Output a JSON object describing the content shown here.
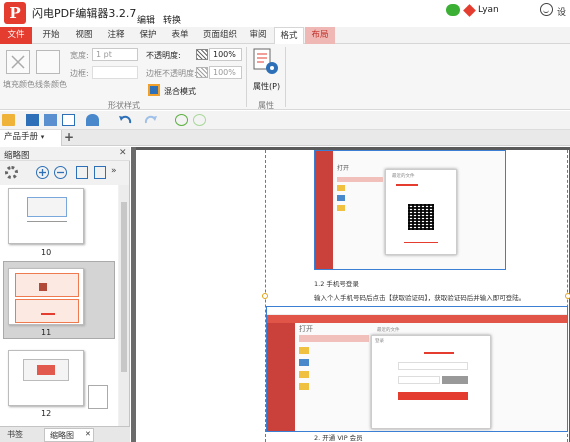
{
  "app": {
    "title": "闪电PDF编辑器3.2.7",
    "menu_edit": "编辑",
    "menu_convert": "转换",
    "user": "Lyan",
    "more": "设"
  },
  "tabs": [
    "文件",
    "开始",
    "视图",
    "注释",
    "保护",
    "表单",
    "页面组织",
    "审阅",
    "格式",
    "布局"
  ],
  "ribbon": {
    "fill_color": "填充颜色",
    "line_color": "线条颜色",
    "width_label": "宽度:",
    "width_value": "1 pt",
    "border_label": "边框:",
    "opacity_label": "不透明度:",
    "opacity_value": "100%",
    "border_opacity_label": "边框不透明度:",
    "border_opacity_value": "100%",
    "blend_mode": "混合模式",
    "group_shape_style": "形状样式",
    "properties_btn": "属性(P)",
    "group_properties": "属性"
  },
  "doc_tab": {
    "name": "产品手册",
    "add": "+"
  },
  "left_panel": {
    "title": "缩略图",
    "close": "✕",
    "pages": [
      "10",
      "11",
      "12"
    ]
  },
  "bottom_tabs": {
    "bookmarks": "书签",
    "thumbnails": "缩略图",
    "close": "✕"
  },
  "document": {
    "heading_login": "1.2 手机号登录",
    "login_instructions": "输入个人手机号码后点击【获取验证码】，获取验证码后并输入即可登陆。",
    "heading_vip": "2. 开通 VIP 会员",
    "screenshot_open_title": "打开",
    "screenshot_login_title": "登录",
    "screenshot_recent": "最近的文件"
  },
  "colors": {
    "accent": "#e43d30",
    "blue": "#2d70b8",
    "green": "#3cb034"
  }
}
